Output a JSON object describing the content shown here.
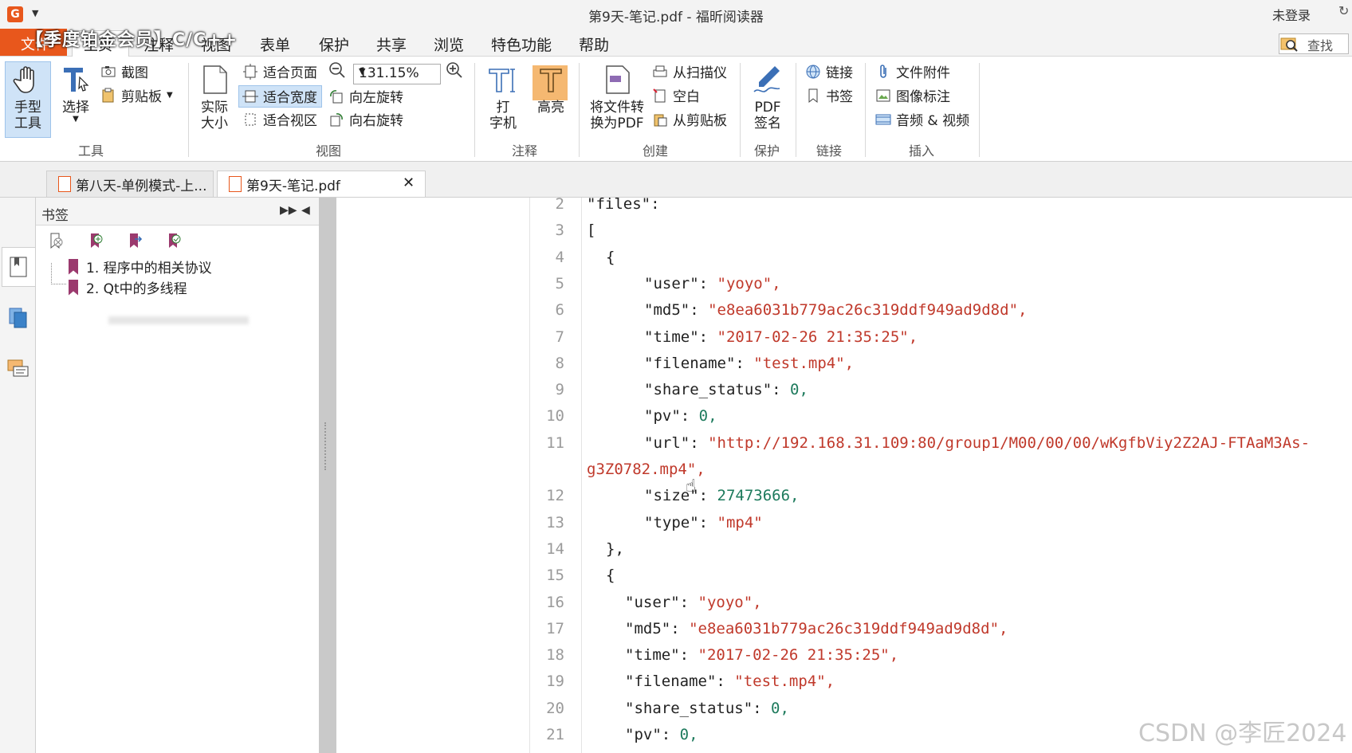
{
  "titlebar": {
    "title": "第9天-笔记.pdf - 福昕阅读器",
    "login": "未登录"
  },
  "menubar": {
    "file_label": "文件",
    "overlay_banner": "【季度铂金会员】C/C++",
    "home_tab": "主页",
    "items": [
      "注释",
      "视图",
      "表单",
      "保护",
      "共享",
      "浏览",
      "特色功能",
      "帮助"
    ],
    "search_label": "查找"
  },
  "ribbon": {
    "tools": {
      "hand": "手型\n工具",
      "select": "选择",
      "screenshot": "截图",
      "clipboard": "剪贴板",
      "group": "工具"
    },
    "view": {
      "actual_size": "实际\n大小",
      "fit_page": "适合页面",
      "fit_width": "适合宽度",
      "fit_visible": "适合视区",
      "zoom_value": "131.15%",
      "rotate_left": "向左旋转",
      "rotate_right": "向右旋转",
      "group": "视图"
    },
    "comment": {
      "typewriter": "打\n字机",
      "highlight": "高亮",
      "group": "注释"
    },
    "create": {
      "convert": "将文件转\n换为PDF",
      "from_scanner": "从扫描仪",
      "blank": "空白",
      "from_clipboard": "从剪贴板",
      "group": "创建"
    },
    "protect": {
      "sign": "PDF\n签名",
      "group": "保护"
    },
    "links": {
      "link": "链接",
      "bookmark": "书签",
      "group": "链接"
    },
    "insert": {
      "attachment": "文件附件",
      "image_annot": "图像标注",
      "audio_video": "音频 & 视频",
      "group": "插入"
    }
  },
  "tabs": [
    {
      "label": "第八天-单例模式-上..."
    },
    {
      "label": "第9天-笔记.pdf"
    }
  ],
  "bookmarks": {
    "title": "书签",
    "items": [
      "1. 程序中的相关协议",
      "2. Qt中的多线程"
    ]
  },
  "code_lines": [
    {
      "n": "2",
      "text": "\"files\":"
    },
    {
      "n": "3",
      "text": "["
    },
    {
      "n": "4",
      "text": "{"
    },
    {
      "n": "5",
      "key": "\"user\"",
      "val": "\"yoyo\","
    },
    {
      "n": "6",
      "key": "\"md5\"",
      "val": "\"e8ea6031b779ac26c319ddf949ad9d8d\","
    },
    {
      "n": "7",
      "key": "\"time\"",
      "val": "\"2017-02-26 21:35:25\","
    },
    {
      "n": "8",
      "key": "\"filename\"",
      "val": "\"test.mp4\","
    },
    {
      "n": "9",
      "key": "\"share_status\"",
      "val": "0,"
    },
    {
      "n": "10",
      "key": "\"pv\"",
      "val": "0,"
    },
    {
      "n": "11",
      "key": "\"url\"",
      "val": "\"http://192.168.31.109:80/group1/M00/00/00/wKgfbViy2Z2AJ-FTAaM3As-"
    },
    {
      "n": "",
      "text": "g3Z0782.mp4\","
    },
    {
      "n": "12",
      "key": "\"size\"",
      "val": "27473666,"
    },
    {
      "n": "13",
      "key": "\"type\"",
      "val": "\"mp4\""
    },
    {
      "n": "14",
      "text": "},"
    },
    {
      "n": "15",
      "text": "{"
    },
    {
      "n": "16",
      "key": "\"user\"",
      "val": "\"yoyo\","
    },
    {
      "n": "17",
      "key": "\"md5\"",
      "val": "\"e8ea6031b779ac26c319ddf949ad9d8d\","
    },
    {
      "n": "18",
      "key": "\"time\"",
      "val": "\"2017-02-26 21:35:25\","
    },
    {
      "n": "19",
      "key": "\"filename\"",
      "val": "\"test.mp4\","
    },
    {
      "n": "20",
      "key": "\"share_status\"",
      "val": "0,"
    },
    {
      "n": "21",
      "key": "\"pv\"",
      "val": "0,"
    }
  ],
  "watermark": "CSDN @李匠2024",
  "colors": {
    "accent": "#e8571c",
    "string": "#c0392b",
    "number": "#1d7a5c",
    "selection": "#cfe3f7"
  }
}
